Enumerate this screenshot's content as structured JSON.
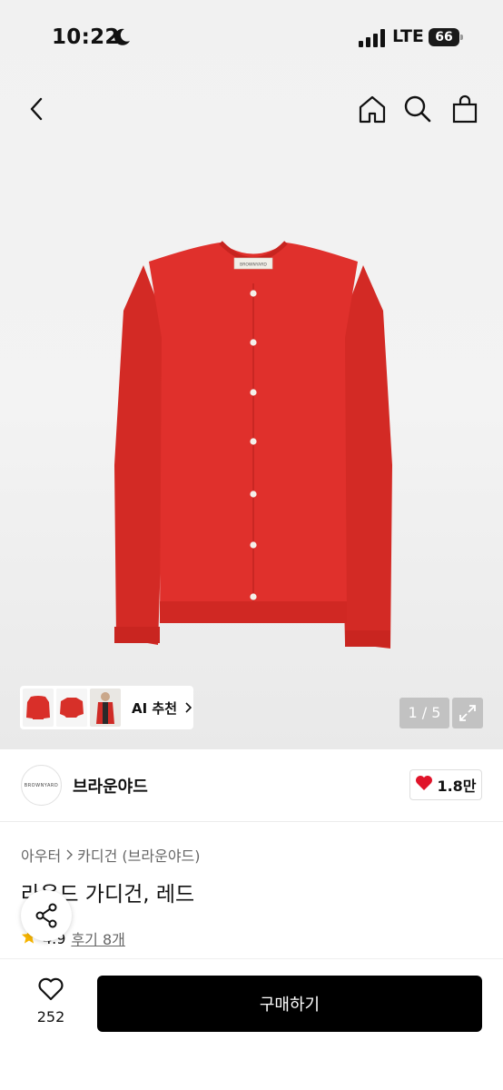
{
  "status_bar": {
    "time": "10:22",
    "network": "LTE",
    "battery": "66"
  },
  "nav": {
    "icons": [
      "back-icon",
      "home-icon",
      "search-icon",
      "shopping-bag-icon"
    ]
  },
  "gallery": {
    "ai_label": "AI 추천",
    "counter": "1 / 5",
    "product_color": "#e0302c"
  },
  "brand": {
    "name": "브라운야드",
    "logo_text": "BROWNYARD",
    "likes": "1.8만"
  },
  "product": {
    "category": [
      "아우터",
      "카디건 (브라운야드)"
    ],
    "title": "라운드 가디건, 레드",
    "rating": "4.9",
    "reviews": "후기 8개"
  },
  "bottom": {
    "wish_count": "252",
    "buy_label": "구매하기"
  }
}
